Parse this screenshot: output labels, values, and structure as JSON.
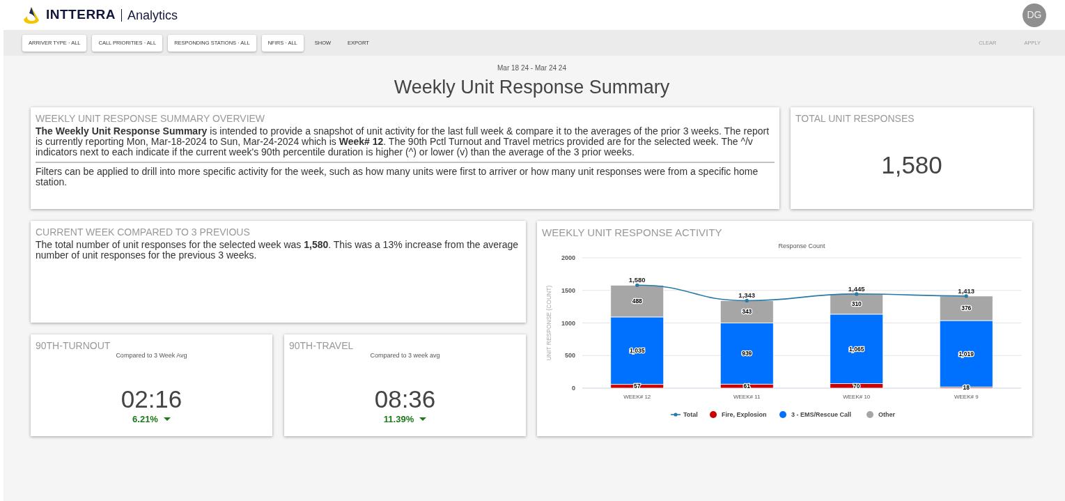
{
  "header": {
    "brand": "INTTERRA",
    "product": "Analytics",
    "avatar": "DG"
  },
  "filters": [
    {
      "label": "ARRIVER TYPE · ALL",
      "kind": "chip"
    },
    {
      "label": "CALL PRIORITIES · ALL",
      "kind": "chip"
    },
    {
      "label": "RESPONDING STATIONS · ALL",
      "kind": "chip"
    },
    {
      "label": "NFIRS · ALL",
      "kind": "chip"
    },
    {
      "label": "SHOW",
      "kind": "text"
    },
    {
      "label": "EXPORT",
      "kind": "text"
    }
  ],
  "actions": [
    {
      "label": "CLEAR",
      "disabled": true
    },
    {
      "label": "APPLY",
      "disabled": true
    }
  ],
  "date_range": "Mar 18 24 - Mar 24 24",
  "page_title": "Weekly Unit Response Summary",
  "overview": {
    "title": "WEEKLY UNIT RESPONSE SUMMARY OVERVIEW",
    "paragraphs": [
      "**The Weekly Unit Response Summary** is intended to provide a snapshot of unit activity for the last full week & compare it to the averages of the prior 3 weeks. The report is currently reporting Mon, Mar-18-2024 to Sun, Mar-24-2024 which is **Week# 12**. The 90th Pctl Turnout and Travel metrics provided are for the selected week. The ^/v indicators next to each indicate if the current week's 90th percentile duration is higher (^) or lower (v) than the average of the 3 prior weeks.",
      "Filters can be applied to drill into more specific activity for the week, such as how many units were first to arriver or how many unit responses were from a specific home station."
    ]
  },
  "total": {
    "title": "TOTAL UNIT RESPONSES",
    "value": "1,580"
  },
  "comparison": {
    "title": "CURRENT WEEK COMPARED TO 3 PREVIOUS",
    "text": "The total number of unit responses for the selected week was **1,580**. This was a 13% increase from the average number of unit responses for the previous 3 weeks."
  },
  "metrics": [
    {
      "title": "90TH-TURNOUT",
      "subtitle": "Compared to 3 Week Avg",
      "value": "02:16",
      "change": "6.21%"
    },
    {
      "title": "90TH-TRAVEL",
      "subtitle": "Compared to 3 week avg",
      "value": "08:36",
      "change": "11.39%"
    }
  ],
  "activity": {
    "title": "WEEKLY UNIT RESPONSE ACTIVITY",
    "chart_data": {
      "type": "bar",
      "stacked": true,
      "title": "Response Count",
      "ylabel": "UNIT RESPONSE (COUNT)",
      "categories": [
        "WEEK# 12",
        "WEEK# 11",
        "WEEK# 10",
        "WEEK# 9"
      ],
      "ylim": [
        0,
        2000
      ],
      "grid": true,
      "legend": "bottom",
      "yticks": [
        0,
        500,
        1000,
        1500,
        2000
      ],
      "series": [
        {
          "name": "Total",
          "color": "#2a7aa8",
          "type": "line",
          "values": [
            1580,
            1343,
            1445,
            1413
          ],
          "value_labels": [
            "1,580",
            "1,343",
            "1,445",
            "1,413"
          ]
        },
        {
          "name": "Fire, Explosion",
          "color": "#cc0000",
          "values": [
            57,
            61,
            70,
            18
          ],
          "value_labels": [
            "57",
            "61",
            "70",
            "18"
          ]
        },
        {
          "name": "3 - EMS/Rescue Call",
          "color": "#0070ff",
          "values": [
            1035,
            939,
            1065,
            1019
          ],
          "value_labels": [
            "1,035",
            "939",
            "1,065",
            "1,019"
          ]
        },
        {
          "name": "Other",
          "color": "#a6a6a6",
          "values": [
            488,
            343,
            310,
            376
          ],
          "value_labels": [
            "488",
            "343",
            "310",
            "376"
          ]
        }
      ]
    }
  }
}
